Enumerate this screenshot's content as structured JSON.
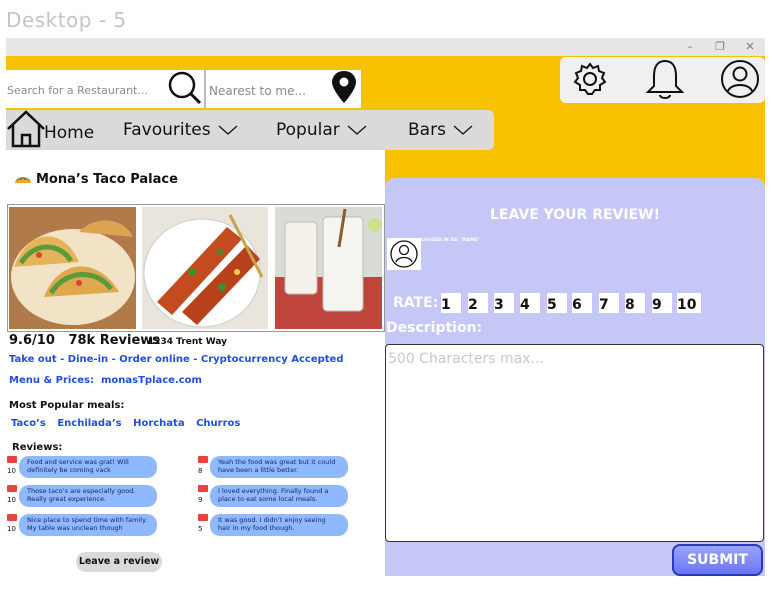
{
  "frame_title": "Desktop - 5",
  "window_controls": {
    "minimize": "–",
    "restore": "❐",
    "close": "✕"
  },
  "search": {
    "placeholder": "Search for a Restaurant...",
    "location_placeholder": "Nearest to me..."
  },
  "nav": {
    "home": "Home",
    "favourites": "Favourites",
    "popular": "Popular",
    "bars": "Bars"
  },
  "icons": [
    "settings-icon",
    "bell-icon",
    "user-icon",
    "home-icon",
    "search-icon",
    "location-pin-icon"
  ],
  "restaurant": {
    "name": "Mona’s Taco Palace",
    "rating": "9.6/10",
    "reviews_count": "78k Reviews",
    "address": "1234 Trent Way",
    "services": "Take out - Dine-in - Order online - Cryptocurrency Accepted",
    "menu_label": "Menu & Prices:",
    "menu_link": "monasTplace.com",
    "popular_heading": "Most Popular meals:",
    "meals": [
      "Taco’s",
      "Enchilada’s",
      "Horchata",
      "Churros"
    ],
    "reviews_heading": "Reviews:",
    "reviews": [
      {
        "score": "10",
        "text": "Food and service was grat! Will definitely be coming vack"
      },
      {
        "score": "8",
        "text": "Yeah the food was great but it could have been a little better."
      },
      {
        "score": "10",
        "text": "Those taco’s are especially good. Really great experience."
      },
      {
        "score": "9",
        "text": "I loved everything. Finally found a place to eat some local meals."
      },
      {
        "score": "10",
        "text": "Nice place to spend time with family. My table was unclean though"
      },
      {
        "score": "5",
        "text": "It was good. I didn’t enjoy seeing hair in my food though."
      }
    ],
    "leave_review_button": "Leave a review"
  },
  "review_form": {
    "title": "LEAVE YOUR REVIEW!",
    "logged_in": "LOGGED IN AS: \"NAME\"",
    "rate_label": "RATE:",
    "rate_options": [
      "1",
      "2",
      "3",
      "4",
      "5",
      "6",
      "7",
      "8",
      "9",
      "10"
    ],
    "description_label": "Description:",
    "description_placeholder": "500 Characters max...",
    "submit": "SUBMIT"
  },
  "colors": {
    "accent_yellow": "#f8c200",
    "panel_lavender": "#c5c7f7",
    "link_blue": "#1f4fd6",
    "bubble_blue": "#8fb8ff"
  }
}
